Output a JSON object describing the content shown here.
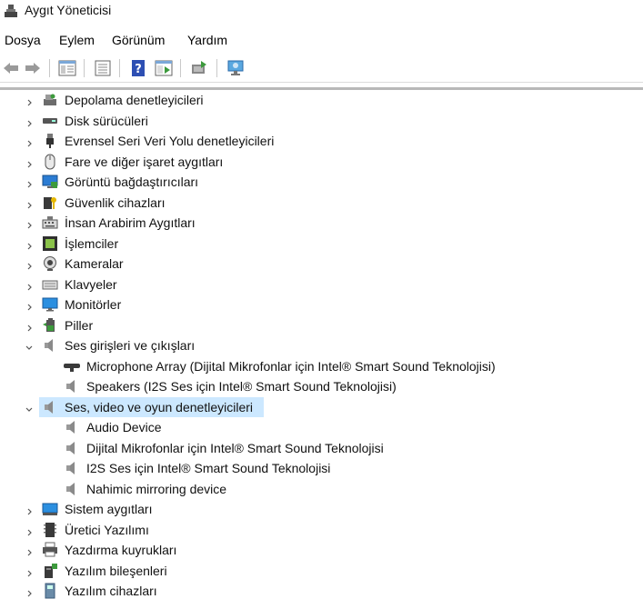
{
  "window": {
    "title": "Aygıt Yöneticisi"
  },
  "menu": {
    "items": [
      "Dosya",
      "Eylem",
      "Görünüm",
      "Yardım"
    ]
  },
  "toolbar": {
    "buttons": [
      "back-icon",
      "forward-icon",
      "properties-pane-icon",
      "list-view-icon",
      "help-icon",
      "show-hidden-icon",
      "update-driver-icon",
      "scan-hardware-icon"
    ]
  },
  "tree": {
    "items": [
      {
        "label": "Depolama denetleyicileri",
        "icon": "storage-controller-icon",
        "level": 0,
        "expanded": false
      },
      {
        "label": "Disk sürücüleri",
        "icon": "disk-drive-icon",
        "level": 0,
        "expanded": false
      },
      {
        "label": "Evrensel Seri Veri Yolu denetleyicileri",
        "icon": "usb-icon",
        "level": 0,
        "expanded": false
      },
      {
        "label": "Fare ve diğer işaret aygıtları",
        "icon": "mouse-icon",
        "level": 0,
        "expanded": false
      },
      {
        "label": "Görüntü bağdaştırıcıları",
        "icon": "display-adapter-icon",
        "level": 0,
        "expanded": false
      },
      {
        "label": "Güvenlik cihazları",
        "icon": "security-device-icon",
        "level": 0,
        "expanded": false
      },
      {
        "label": "İnsan Arabirim Aygıtları",
        "icon": "hid-icon",
        "level": 0,
        "expanded": false
      },
      {
        "label": "İşlemciler",
        "icon": "processor-icon",
        "level": 0,
        "expanded": false
      },
      {
        "label": "Kameralar",
        "icon": "camera-icon",
        "level": 0,
        "expanded": false
      },
      {
        "label": "Klavyeler",
        "icon": "keyboard-icon",
        "level": 0,
        "expanded": false
      },
      {
        "label": "Monitörler",
        "icon": "monitor-icon",
        "level": 0,
        "expanded": false
      },
      {
        "label": "Piller",
        "icon": "battery-icon",
        "level": 0,
        "expanded": false
      },
      {
        "label": "Ses girişleri ve çıkışları",
        "icon": "speaker-icon",
        "level": 0,
        "expanded": true
      },
      {
        "label": "Microphone Array (Dijital Mikrofonlar için Intel® Smart Sound Teknolojisi)",
        "icon": "microphone-array-icon",
        "level": 1
      },
      {
        "label": "Speakers (I2S Ses için Intel® Smart Sound Teknolojisi)",
        "icon": "speaker-icon",
        "level": 1
      },
      {
        "label": "Ses, video ve oyun denetleyicileri",
        "icon": "speaker-icon",
        "level": 0,
        "expanded": true,
        "selected": true
      },
      {
        "label": "Audio Device",
        "icon": "speaker-icon",
        "level": 1
      },
      {
        "label": "Dijital Mikrofonlar için Intel® Smart Sound Teknolojisi",
        "icon": "speaker-icon",
        "level": 1
      },
      {
        "label": "I2S Ses için Intel® Smart Sound Teknolojisi",
        "icon": "speaker-icon",
        "level": 1
      },
      {
        "label": "Nahimic mirroring device",
        "icon": "speaker-icon",
        "level": 1
      },
      {
        "label": "Sistem aygıtları",
        "icon": "system-device-icon",
        "level": 0,
        "expanded": false
      },
      {
        "label": "Üretici Yazılımı",
        "icon": "firmware-icon",
        "level": 0,
        "expanded": false
      },
      {
        "label": "Yazdırma kuyrukları",
        "icon": "printer-icon",
        "level": 0,
        "expanded": false
      },
      {
        "label": "Yazılım bileşenleri",
        "icon": "software-component-icon",
        "level": 0,
        "expanded": false
      },
      {
        "label": "Yazılım cihazları",
        "icon": "software-device-icon",
        "level": 0,
        "expanded": false
      }
    ]
  },
  "colors": {
    "selection": "#cce8ff",
    "accent": "#2b7cd3"
  }
}
